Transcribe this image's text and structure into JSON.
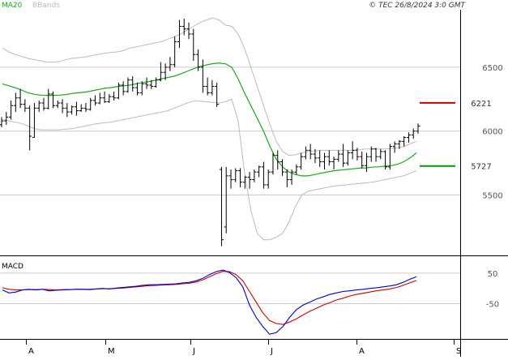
{
  "legend": {
    "ma": "MA20",
    "bb": "BBands"
  },
  "copyright": "© TEC 26/8/2024 3:0 GMT",
  "colors": {
    "ma": "#1aa81a",
    "bb": "#bbbbbb",
    "price": "#000000",
    "grid": "#cccccc",
    "resistance": "#cc0000",
    "support": "#009900",
    "macd": "#0000cc",
    "signal": "#cc0000"
  },
  "chart_data": [
    {
      "type": "candlestick",
      "panel": "price",
      "y_ticks": [
        "6500",
        "6000",
        "5500"
      ],
      "ylim": [
        5040,
        6950
      ],
      "x_ticks": [
        "A",
        "M",
        "J",
        "J",
        "A",
        "S"
      ],
      "levels": [
        {
          "label": "6221",
          "value": 6221,
          "color": "#cc0000"
        },
        {
          "label": "5727",
          "value": 5727,
          "color": "#009900"
        }
      ],
      "series": [
        {
          "name": "MA20",
          "values": [
            6370,
            6355,
            6340,
            6322,
            6300,
            6288,
            6282,
            6280,
            6280,
            6282,
            6286,
            6295,
            6300,
            6305,
            6315,
            6325,
            6335,
            6340,
            6348,
            6355,
            6360,
            6370,
            6380,
            6388,
            6398,
            6410,
            6420,
            6430,
            6448,
            6468,
            6488,
            6505,
            6518,
            6528,
            6533,
            6527,
            6500,
            6410,
            6300,
            6200,
            6100,
            6000,
            5880,
            5780,
            5720,
            5680,
            5660,
            5650,
            5650,
            5660,
            5670,
            5680,
            5690,
            5695,
            5700,
            5705,
            5710,
            5712,
            5718,
            5720,
            5725,
            5730,
            5740,
            5760,
            5790,
            5830
          ]
        },
        {
          "name": "BB upper",
          "values": [
            6650,
            6620,
            6600,
            6585,
            6570,
            6560,
            6550,
            6540,
            6540,
            6545,
            6560,
            6570,
            6575,
            6580,
            6590,
            6600,
            6610,
            6615,
            6620,
            6630,
            6650,
            6660,
            6670,
            6680,
            6690,
            6700,
            6720,
            6740,
            6760,
            6790,
            6820,
            6850,
            6870,
            6885,
            6870,
            6830,
            6820,
            6760,
            6650,
            6500,
            6350,
            6200,
            6050,
            5920,
            5840,
            5810,
            5815,
            5830,
            5840,
            5845,
            5850,
            5850,
            5850,
            5850,
            5850,
            5850,
            5855,
            5860,
            5860,
            5860,
            5860,
            5865,
            5870,
            5880,
            5900,
            5920
          ]
        },
        {
          "name": "BB lower",
          "values": [
            6090,
            6080,
            6070,
            6060,
            6040,
            6020,
            6010,
            6010,
            6010,
            6010,
            6015,
            6020,
            6030,
            6040,
            6050,
            6060,
            6065,
            6070,
            6080,
            6090,
            6100,
            6110,
            6120,
            6130,
            6140,
            6150,
            6160,
            6180,
            6200,
            6220,
            6235,
            6235,
            6230,
            6225,
            6220,
            6230,
            6250,
            6080,
            5680,
            5380,
            5200,
            5150,
            5150,
            5170,
            5200,
            5290,
            5410,
            5500,
            5530,
            5540,
            5550,
            5560,
            5570,
            5575,
            5580,
            5585,
            5590,
            5595,
            5600,
            5610,
            5620,
            5630,
            5640,
            5650,
            5670,
            5690
          ]
        }
      ],
      "ohlc": [
        [
          6050,
          6110,
          6030,
          6080
        ],
        [
          6080,
          6150,
          6050,
          6110
        ],
        [
          6110,
          6240,
          6090,
          6200
        ],
        [
          6200,
          6300,
          6150,
          6260
        ],
        [
          6260,
          6330,
          6180,
          6210
        ],
        [
          6210,
          6250,
          6150,
          6180
        ],
        [
          6180,
          6200,
          5850,
          5960
        ],
        [
          5950,
          6220,
          5950,
          6180
        ],
        [
          6180,
          6240,
          6150,
          6220
        ],
        [
          6220,
          6260,
          6160,
          6180
        ],
        [
          6180,
          6330,
          6170,
          6290
        ],
        [
          6290,
          6310,
          6180,
          6200
        ],
        [
          6200,
          6240,
          6180,
          6220
        ],
        [
          6220,
          6250,
          6140,
          6180
        ],
        [
          6180,
          6220,
          6110,
          6150
        ],
        [
          6150,
          6200,
          6130,
          6190
        ],
        [
          6190,
          6230,
          6120,
          6160
        ],
        [
          6160,
          6210,
          6150,
          6180
        ],
        [
          6180,
          6220,
          6150,
          6170
        ],
        [
          6170,
          6260,
          6160,
          6240
        ],
        [
          6240,
          6280,
          6200,
          6220
        ],
        [
          6220,
          6300,
          6210,
          6260
        ],
        [
          6260,
          6310,
          6220,
          6230
        ],
        [
          6230,
          6290,
          6220,
          6270
        ],
        [
          6270,
          6310,
          6240,
          6260
        ],
        [
          6260,
          6380,
          6250,
          6360
        ],
        [
          6360,
          6390,
          6280,
          6310
        ],
        [
          6310,
          6420,
          6300,
          6400
        ],
        [
          6400,
          6430,
          6310,
          6340
        ],
        [
          6340,
          6380,
          6280,
          6300
        ],
        [
          6300,
          6390,
          6280,
          6370
        ],
        [
          6370,
          6420,
          6330,
          6360
        ],
        [
          6360,
          6400,
          6330,
          6350
        ],
        [
          6350,
          6420,
          6340,
          6400
        ],
        [
          6400,
          6540,
          6390,
          6460
        ],
        [
          6460,
          6530,
          6400,
          6500
        ],
        [
          6500,
          6580,
          6470,
          6520
        ],
        [
          6520,
          6740,
          6500,
          6700
        ],
        [
          6700,
          6870,
          6650,
          6820
        ],
        [
          6820,
          6880,
          6750,
          6800
        ],
        [
          6800,
          6850,
          6720,
          6760
        ],
        [
          6760,
          6800,
          6550,
          6600
        ],
        [
          6600,
          6640,
          6470,
          6500
        ],
        [
          6500,
          6560,
          6300,
          6350
        ],
        [
          6350,
          6420,
          6280,
          6300
        ],
        [
          6300,
          6400,
          6280,
          6350
        ],
        [
          6350,
          6380,
          6190,
          6210
        ],
        [
          5700,
          5720,
          5100,
          5150
        ],
        [
          5250,
          5720,
          5200,
          5650
        ],
        [
          5650,
          5700,
          5550,
          5620
        ],
        [
          5620,
          5710,
          5600,
          5690
        ],
        [
          5690,
          5710,
          5560,
          5600
        ],
        [
          5600,
          5650,
          5550,
          5640
        ],
        [
          5640,
          5680,
          5550,
          5620
        ],
        [
          5620,
          5700,
          5600,
          5680
        ],
        [
          5680,
          5730,
          5640,
          5720
        ],
        [
          5720,
          5760,
          5550,
          5580
        ],
        [
          5580,
          5700,
          5550,
          5680
        ],
        [
          5680,
          5830,
          5660,
          5810
        ],
        [
          5810,
          5850,
          5700,
          5760
        ],
        [
          5760,
          5780,
          5650,
          5680
        ],
        [
          5680,
          5700,
          5560,
          5620
        ],
        [
          5620,
          5700,
          5580,
          5680
        ],
        [
          5680,
          5740,
          5660,
          5720
        ],
        [
          5720,
          5830,
          5700,
          5800
        ],
        [
          5800,
          5880,
          5780,
          5850
        ],
        [
          5850,
          5900,
          5780,
          5820
        ],
        [
          5820,
          5860,
          5750,
          5790
        ],
        [
          5790,
          5850,
          5720,
          5760
        ],
        [
          5760,
          5830,
          5700,
          5800
        ],
        [
          5800,
          5850,
          5730,
          5760
        ],
        [
          5760,
          5800,
          5700,
          5780
        ],
        [
          5780,
          5850,
          5760,
          5820
        ],
        [
          5820,
          5900,
          5720,
          5750
        ],
        [
          5750,
          5850,
          5730,
          5830
        ],
        [
          5830,
          5920,
          5780,
          5850
        ],
        [
          5850,
          5870,
          5770,
          5800
        ],
        [
          5800,
          5840,
          5710,
          5730
        ],
        [
          5730,
          5830,
          5680,
          5800
        ],
        [
          5800,
          5880,
          5760,
          5860
        ],
        [
          5860,
          5870,
          5760,
          5800
        ],
        [
          5800,
          5860,
          5780,
          5840
        ],
        [
          5840,
          5850,
          5700,
          5720
        ],
        [
          5720,
          5900,
          5700,
          5880
        ],
        [
          5880,
          5920,
          5830,
          5900
        ],
        [
          5900,
          5930,
          5860,
          5920
        ],
        [
          5920,
          5960,
          5880,
          5950
        ],
        [
          5950,
          5990,
          5910,
          5970
        ],
        [
          5970,
          6020,
          5940,
          6000
        ],
        [
          6000,
          6060,
          5980,
          6040
        ]
      ]
    },
    {
      "type": "line",
      "panel": "macd",
      "title": "MACD",
      "y_ticks": [
        "50",
        "-50"
      ],
      "ylim": [
        -160,
        100
      ],
      "series": [
        {
          "name": "MACD",
          "values": [
            -5,
            -15,
            -12,
            -5,
            -3,
            -5,
            -3,
            -8,
            -6,
            -5,
            -4,
            -3,
            -3,
            -4,
            -2,
            0,
            -2,
            1,
            3,
            5,
            7,
            10,
            12,
            12,
            13,
            14,
            15,
            18,
            20,
            25,
            33,
            45,
            55,
            60,
            52,
            35,
            5,
            -55,
            -95,
            -125,
            -150,
            -145,
            -125,
            -95,
            -70,
            -55,
            -45,
            -35,
            -28,
            -20,
            -15,
            -10,
            -8,
            -5,
            -3,
            0,
            2,
            5,
            8,
            12,
            20,
            30,
            38
          ]
        },
        {
          "name": "Signal",
          "values": [
            2,
            -3,
            -5,
            -5,
            -4,
            -4,
            -3,
            -4,
            -5,
            -4,
            -4,
            -3,
            -3,
            -3,
            -2,
            -1,
            -1,
            0,
            1,
            3,
            5,
            7,
            9,
            10,
            11,
            12,
            13,
            15,
            17,
            21,
            28,
            38,
            48,
            56,
            55,
            45,
            25,
            -10,
            -45,
            -80,
            -105,
            -115,
            -118,
            -110,
            -100,
            -87,
            -75,
            -65,
            -55,
            -47,
            -38,
            -32,
            -25,
            -20,
            -16,
            -12,
            -8,
            -5,
            -2,
            3,
            10,
            18,
            26
          ]
        }
      ]
    }
  ]
}
